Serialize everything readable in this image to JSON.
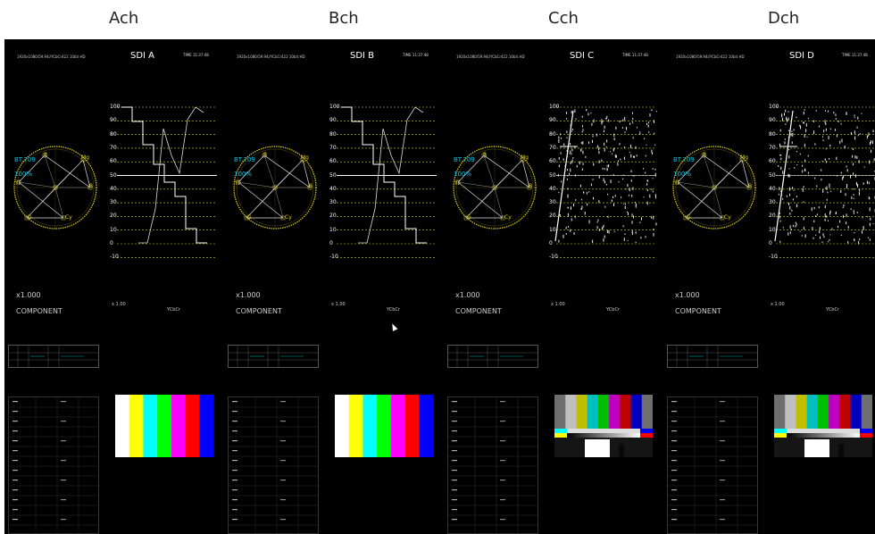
{
  "channels": [
    {
      "label": "Ach",
      "title": "SDI A",
      "time": "TIME 11:37:48",
      "header": "1920x1080/59.94i/YCbCr422 10bit HD",
      "pattern": "colorbar"
    },
    {
      "label": "Bch",
      "title": "SDI B",
      "time": "TIME 11:37:48",
      "header": "1920x1080/59.94i/YCbCr422 10bit HD",
      "pattern": "colorbar"
    },
    {
      "label": "Cch",
      "title": "SDI C",
      "time": "TIME 11:37:48",
      "header": "1920x1080/59.94i/YCbCr422 10bit HD",
      "pattern": "smpte"
    },
    {
      "label": "Dch",
      "title": "SDI D",
      "time": "TIME 11:37:48",
      "header": "1920x1080/59.94i/YCbCr422 10bit HD",
      "pattern": "smpte"
    }
  ],
  "vectorscope": {
    "standard": "BT.709",
    "level": "100%",
    "targets": [
      "R",
      "Mg",
      "B",
      "Cy",
      "G",
      "Yl"
    ],
    "zoom": "x1.000",
    "mode": "COMPONENT"
  },
  "waveform": {
    "tick_labels": [
      "100",
      "90",
      "80",
      "70",
      "60",
      "50",
      "40",
      "30",
      "20",
      "10",
      "0",
      "-10"
    ],
    "scale": "x 1.00",
    "format": "YCbCr"
  },
  "colors": {
    "scope": "#e0d020",
    "accent": "#00c8e8",
    "background": "#000000"
  },
  "colorbar": [
    "#ffffff",
    "#ffff00",
    "#00ffff",
    "#00ff00",
    "#ff00ff",
    "#ff0000",
    "#0000ff"
  ],
  "smpte_top": [
    "#6e6e6e",
    "#bfbfbf",
    "#bfbf00",
    "#00bfbf",
    "#00bf00",
    "#bf00bf",
    "#bf0000",
    "#0000bf",
    "#6e6e6e"
  ]
}
